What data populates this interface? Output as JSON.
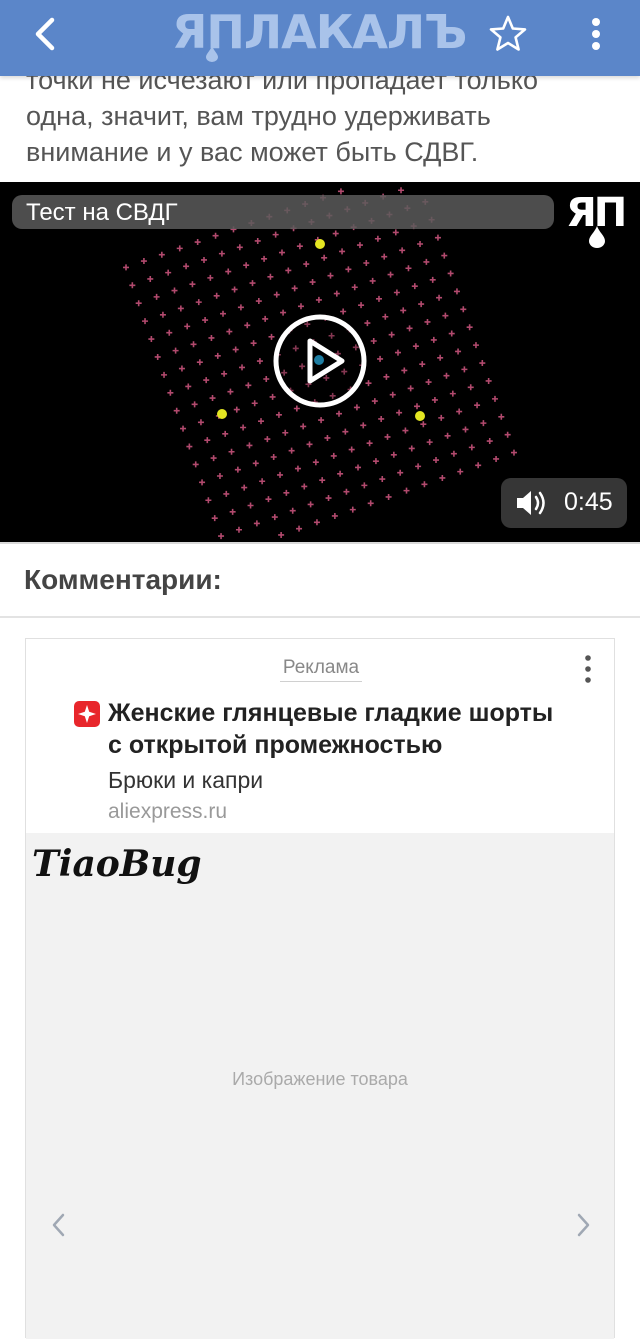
{
  "header": {
    "logo_text": "ЯПЛАКАЛЪ",
    "back_icon": "chevron-left-icon",
    "star_icon": "star-outline-icon",
    "more_icon": "more-vertical-icon",
    "background_color": "#5b86c9"
  },
  "article": {
    "text_line1": "точки не исчезают или пропадает только",
    "text_line2": "одна, значит, вам трудно удерживать",
    "text_line3": "внимание и у вас может быть СДВГ."
  },
  "video": {
    "title": "Тест на СВДГ",
    "channel_logo": "ЯП",
    "duration": "0:45",
    "play_icon": "play-icon",
    "volume_icon": "volume-icon"
  },
  "comments": {
    "heading": "Комментарии:"
  },
  "ad": {
    "label": "Реклама",
    "title_line1": "Женские глянцевые гладкие шорты",
    "title_line2": "с открытой промежностью",
    "category": "Брюки и капри",
    "domain": "aliexpress.ru",
    "brand": "TiaoBug",
    "image_placeholder": "Изображение товара",
    "accent_color": "#e8262b"
  }
}
